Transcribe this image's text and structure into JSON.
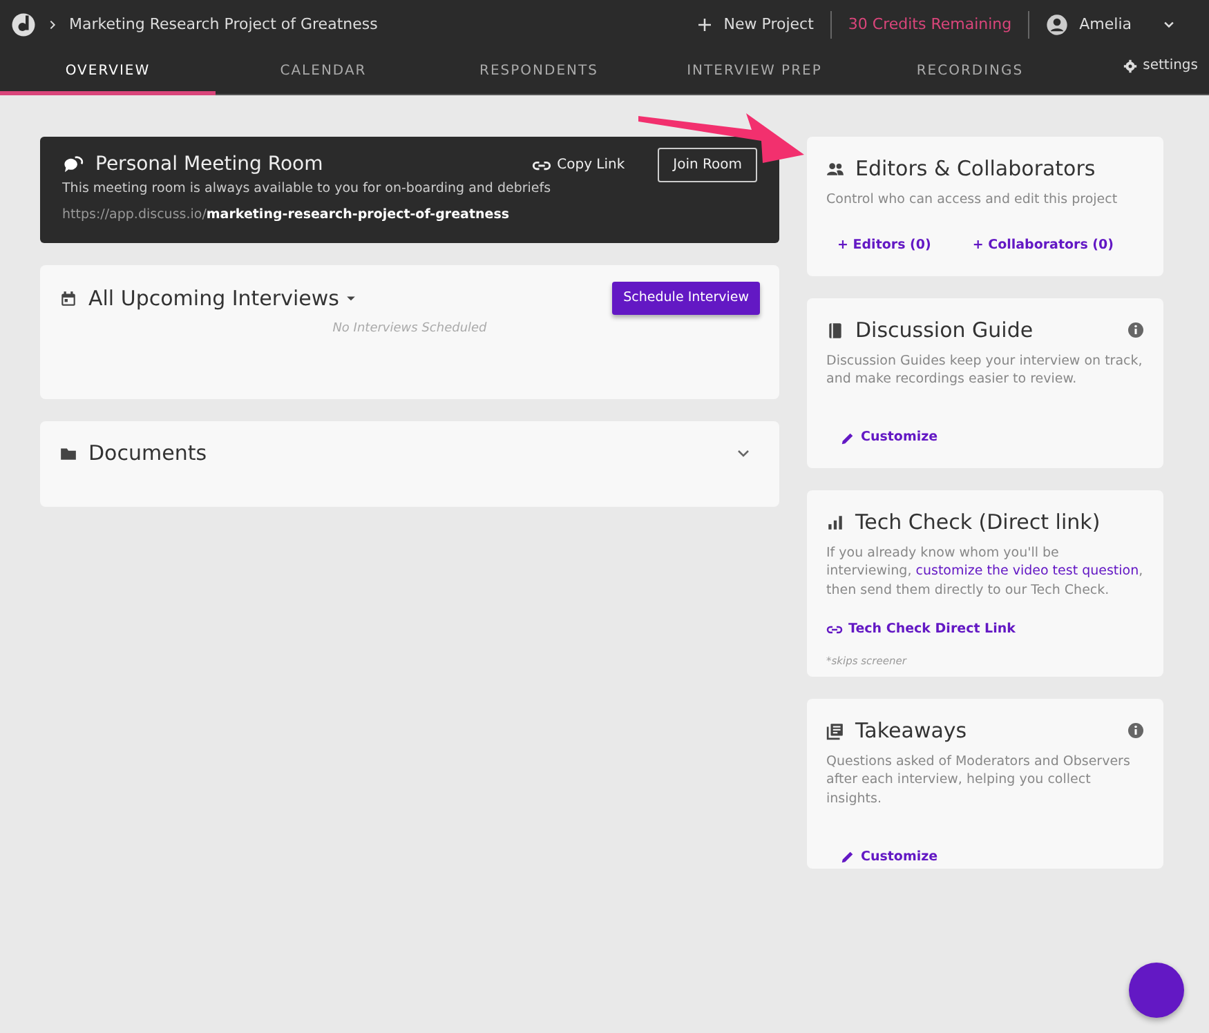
{
  "topbar": {
    "breadcrumb": "Marketing Research Project of Greatness",
    "new_project": "New Project",
    "credits": "30 Credits Remaining",
    "user": "Amelia"
  },
  "tabs": [
    {
      "label": "OVERVIEW",
      "selected": true
    },
    {
      "label": "CALENDAR",
      "selected": false
    },
    {
      "label": "RESPONDENTS",
      "selected": false
    },
    {
      "label": "INTERVIEW PREP",
      "selected": false
    },
    {
      "label": "RECORDINGS",
      "selected": false
    }
  ],
  "settings": "settings",
  "meeting_room": {
    "title": "Personal Meeting Room",
    "copy_link": "Copy Link",
    "join": "Join Room",
    "description": "This meeting room is always available to you for on-boarding and debriefs",
    "url_base": "https://app.discuss.io/",
    "url_slug": "marketing-research-project-of-greatness"
  },
  "interviews": {
    "title": "All Upcoming Interviews",
    "button": "Schedule Interview",
    "empty": "No Interviews Scheduled"
  },
  "documents": {
    "title": "Documents",
    "expanded": false
  },
  "side_cards": [
    {
      "kind": "people",
      "title": "Editors & Collaborators",
      "description": "Control who can access and edit this project",
      "links": [
        "+ Editors (0)",
        "+ Collaborators (0)"
      ]
    },
    {
      "kind": "guide",
      "title": "Discussion Guide",
      "description": "Discussion Guides keep your interview on track, and make recordings easier to review.",
      "action": "Customize"
    },
    {
      "kind": "techcheck",
      "title": "Tech Check (Direct link)",
      "description_before": "If you already know whom you'll be interviewing,",
      "description_link": "customize the video test question",
      "description_after": ", then send them directly to our Tech Check.",
      "action": "Tech Check Direct Link",
      "note": "*skips screener"
    },
    {
      "kind": "takeaways",
      "title": "Takeaways",
      "description": "Questions asked of Moderators and Observers after each interview, helping you collect insights.",
      "action": "Customize"
    }
  ]
}
